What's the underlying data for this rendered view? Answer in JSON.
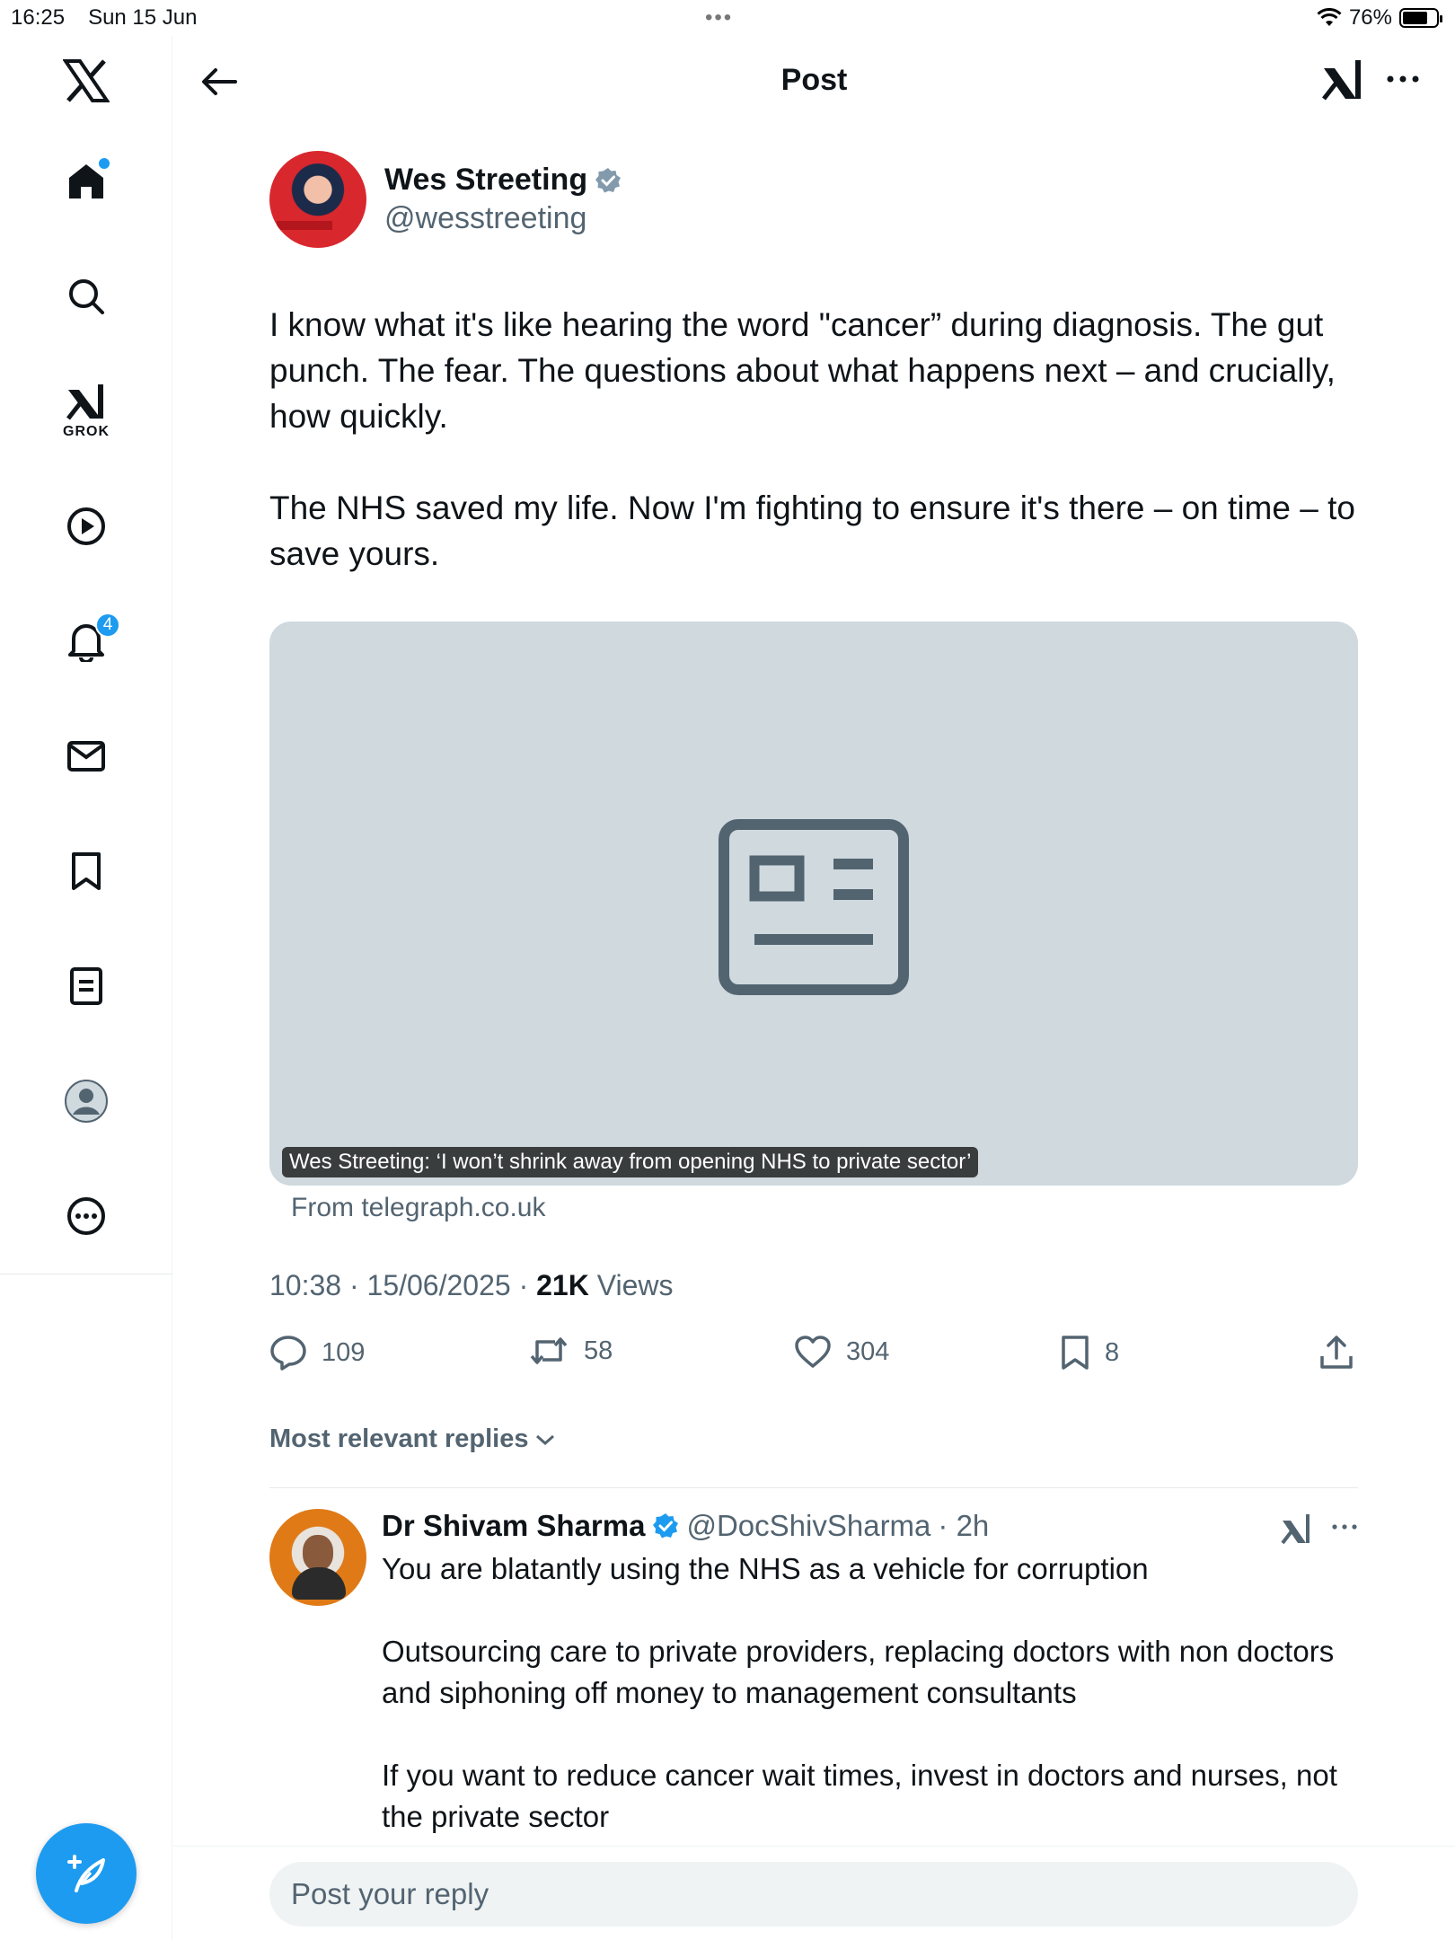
{
  "status_bar": {
    "time": "16:25",
    "date": "Sun 15 Jun",
    "battery": "76%",
    "battery_level": 0.76
  },
  "header": {
    "title": "Post"
  },
  "sidebar": {
    "grok_label": "GROK",
    "notification_count": "4"
  },
  "post": {
    "author_name": "Wes Streeting",
    "author_handle": "@wesstreeting",
    "paragraphs": [
      "I know what it's like hearing the word \"cancer” during diagnosis. The gut punch. The fear. The questions about what happens next – and crucially, how quickly.",
      "The NHS saved my life. Now I'm fighting to ensure it's there – on time – to save yours."
    ],
    "card_caption": "Wes Streeting: ‘I won’t shrink away from opening NHS to private sector’",
    "card_source": "From telegraph.co.uk",
    "timestamp": "10:38 · 15/06/2025 · ",
    "views_count": "21K",
    "views_label": " Views",
    "replies": "109",
    "reposts": "58",
    "likes": "304",
    "bookmarks": "8"
  },
  "replies_section": {
    "sort_label": "Most relevant replies"
  },
  "reply": {
    "name": "Dr Shivam Sharma",
    "handle": "@DocShivSharma",
    "time": "· 2h",
    "paragraphs": [
      "You are blatantly using the NHS as a vehicle for corruption",
      "Outsourcing care to private providers, replacing doctors with non doctors and siphoning off money to management consultants",
      "If you want to reduce cancer wait times, invest in doctors and nurses, not the private sector"
    ]
  },
  "reply_bar": {
    "placeholder": "Post your reply"
  },
  "colors": {
    "accent": "#1d9bf0",
    "muted": "#536471",
    "card_bg": "#cfd9de"
  }
}
